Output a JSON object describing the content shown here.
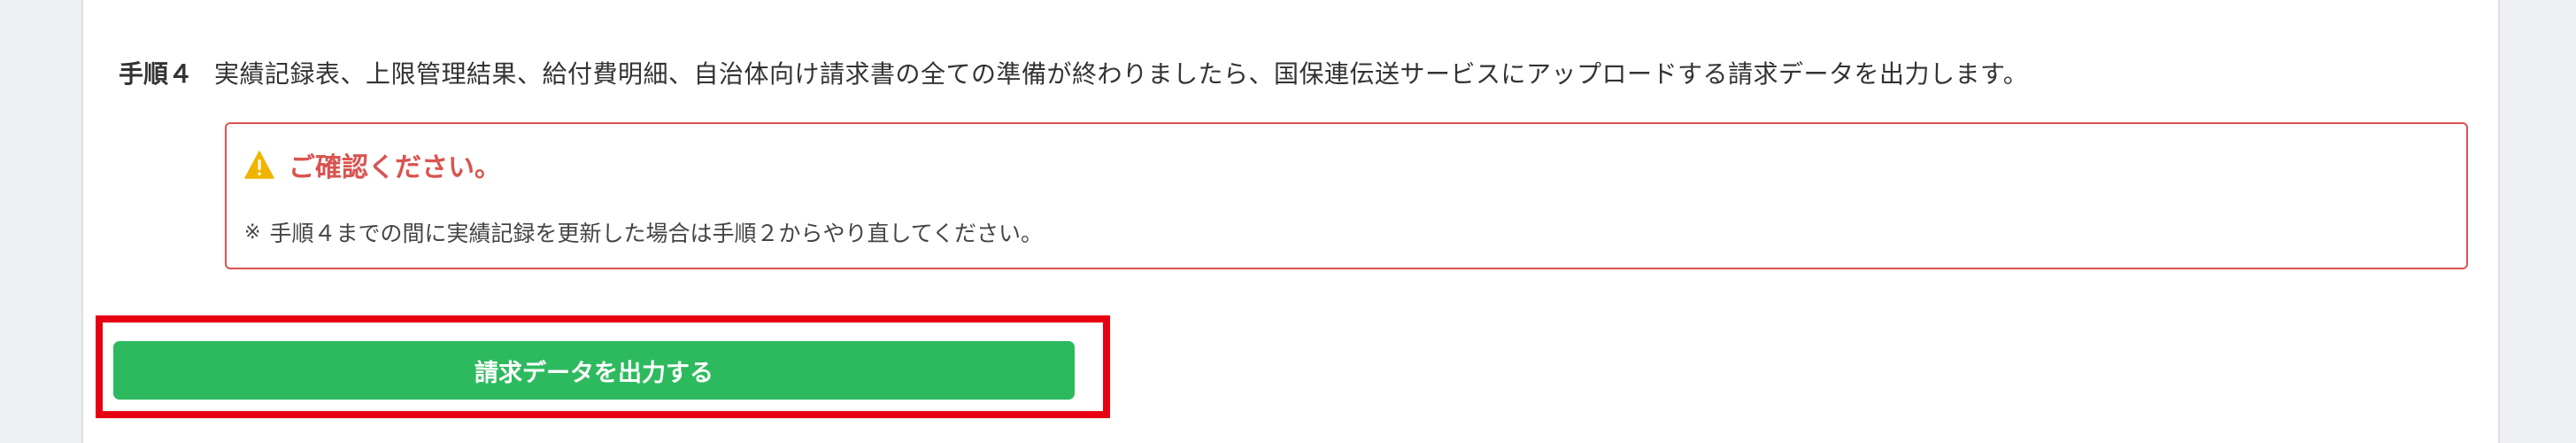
{
  "step": {
    "label": "手順４",
    "text": "実績記録表、上限管理結果、給付費明細、自治体向け請求書の全ての準備が終わりましたら、国保連伝送サービスにアップロードする請求データを出力します。"
  },
  "notice": {
    "icon": "warning-triangle-icon",
    "title": "ご確認ください。",
    "asterisk": "※",
    "body": "手順４までの間に実績記録を更新した場合は手順２からやり直してください。"
  },
  "action": {
    "export_label": "請求データを出力する"
  },
  "colors": {
    "accent_green": "#2dba5e",
    "warning_red": "#d9534f",
    "warning_icon": "#f0b400",
    "highlight": "#e60012"
  }
}
